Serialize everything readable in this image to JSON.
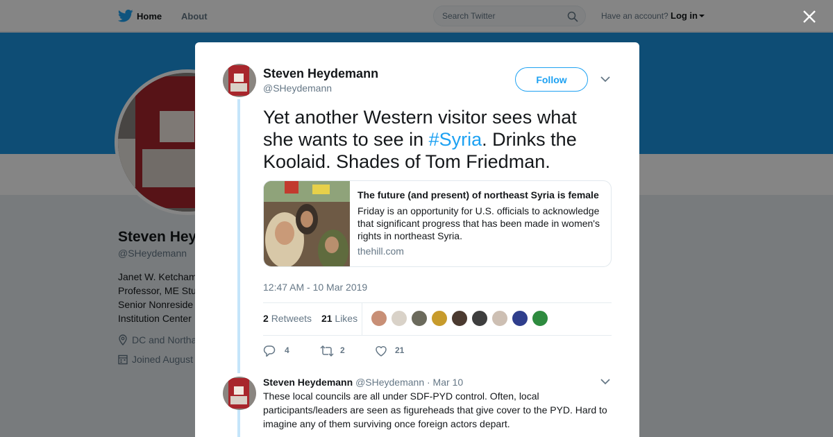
{
  "nav": {
    "home_label": "Home",
    "about_label": "About",
    "search_placeholder": "Search Twitter",
    "have_account": "Have an account?",
    "login_label": "Log in"
  },
  "profile": {
    "name_partial": "Steven Hey",
    "handle": "@SHeydemann",
    "bio_lines": [
      "Janet W. Ketcham",
      "Professor, ME Stu",
      "Senior Nonreside",
      "Institution Center"
    ],
    "location_partial": "DC and Northa",
    "joined_partial": "Joined August"
  },
  "tweet": {
    "author_name": "Steven Heydemann",
    "author_handle": "@SHeydemann",
    "follow_label": "Follow",
    "text_before": "Yet another Western visitor sees what she wants to see in ",
    "hashtag": "#Syria",
    "text_after": ". Drinks the Koolaid. Shades of Tom Friedman.",
    "card": {
      "title": "The future (and present) of northeast Syria is female",
      "description": "Friday is an opportunity for U.S. officials to acknowledge that significant progress that has been made in women's rights in northeast Syria.",
      "domain": "thehill.com"
    },
    "timestamp": "12:47 AM - 10 Mar 2019",
    "retweets_count": "2",
    "retweets_label": "Retweets",
    "likes_count": "21",
    "likes_label": "Likes",
    "actions": {
      "reply_count": "4",
      "retweet_count": "2",
      "like_count": "21"
    }
  },
  "reply": {
    "author_name": "Steven Heydemann",
    "author_handle": "@SHeydemann",
    "date": "· Mar 10",
    "text": "These local councils are all under SDF-PYD control. Often, local participants/leaders are seen as figureheads that give cover to the PYD. Hard to imagine any of them surviving once foreign actors depart."
  },
  "icons": {
    "brand": "twitter-bird-icon",
    "search": "search-icon",
    "close": "close-icon",
    "more": "chevron-down-icon",
    "reply": "reply-icon",
    "retweet": "retweet-icon",
    "like": "heart-icon",
    "location": "location-icon",
    "calendar": "calendar-icon"
  },
  "colors": {
    "brand_blue": "#1da1f2",
    "banner_blue": "#1b95e0",
    "text": "#14171a",
    "muted": "#657786",
    "thread": "#c5e5fa"
  }
}
